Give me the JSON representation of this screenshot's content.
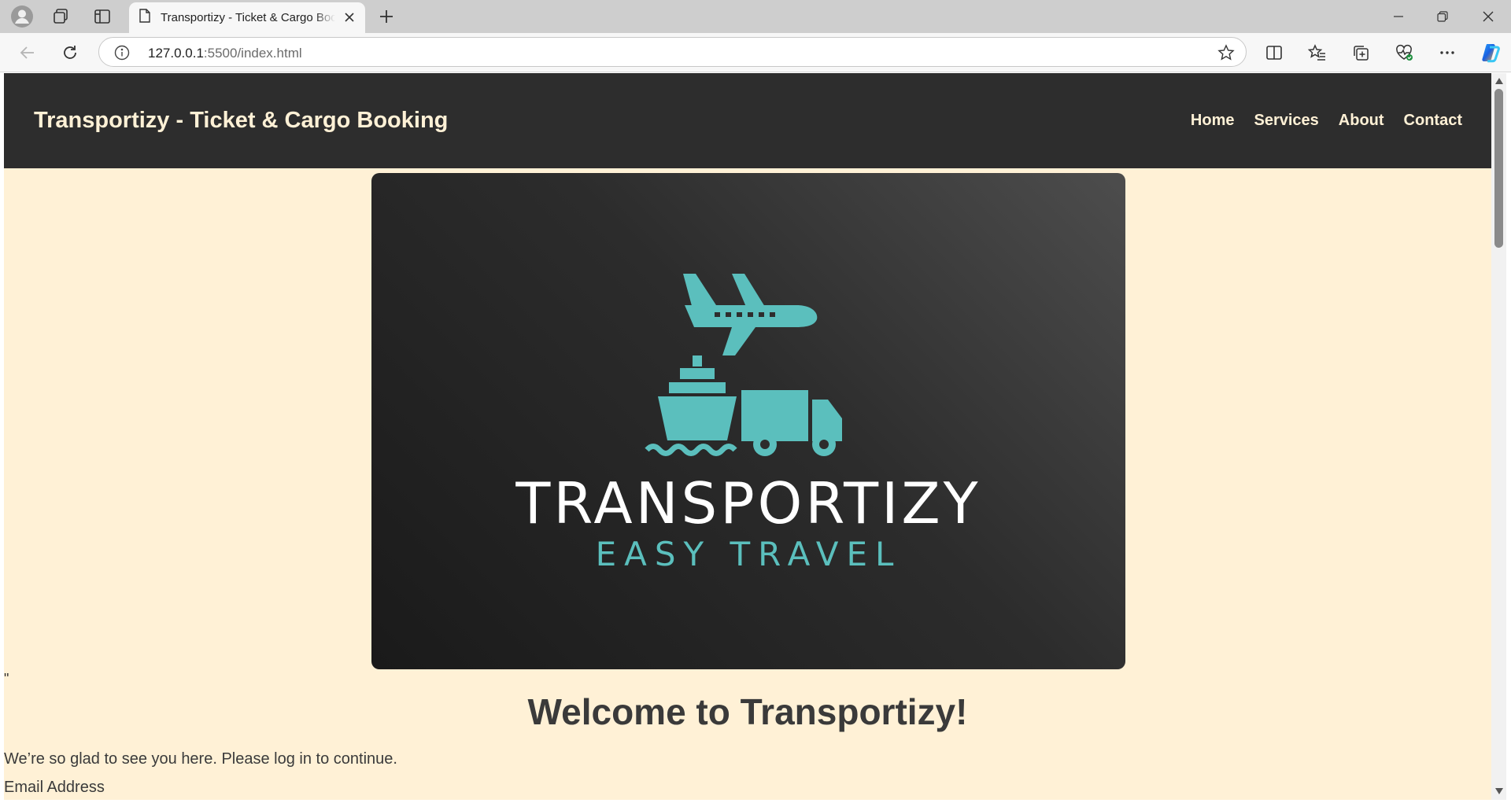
{
  "browser": {
    "tab_title": "Transportizy - Ticket & Cargo Booking",
    "url_host": "127.0.0.1",
    "url_rest": ":5500/index.html",
    "icons": [
      "profile-icon",
      "workspaces-icon",
      "tab-actions-icon",
      "page-icon",
      "close-icon",
      "new-tab-icon",
      "minimize-icon",
      "restore-icon",
      "window-close-icon",
      "back-icon",
      "refresh-icon",
      "info-icon",
      "star-icon",
      "split-screen-icon",
      "favorites-icon",
      "collections-icon",
      "browser-essentials-icon",
      "more-icon",
      "copilot-icon"
    ]
  },
  "header": {
    "title": "Transportizy - Ticket & Cargo Booking",
    "nav": [
      {
        "label": "Home"
      },
      {
        "label": "Services"
      },
      {
        "label": "About"
      },
      {
        "label": "Contact"
      }
    ]
  },
  "hero": {
    "brand_name": "TRANSPORTIZY",
    "tagline": "EASY TRAVEL",
    "accent_color": "#5bbfbd"
  },
  "main": {
    "stray_char": "\"",
    "welcome": "Welcome to Transportizy!",
    "intro": "We’re so glad to see you here. Please log in to continue.",
    "email_label": "Email Address"
  },
  "colors": {
    "header_bg": "#2d2d2d",
    "page_bg": "#fff1d6",
    "header_text": "#fff1d6"
  }
}
